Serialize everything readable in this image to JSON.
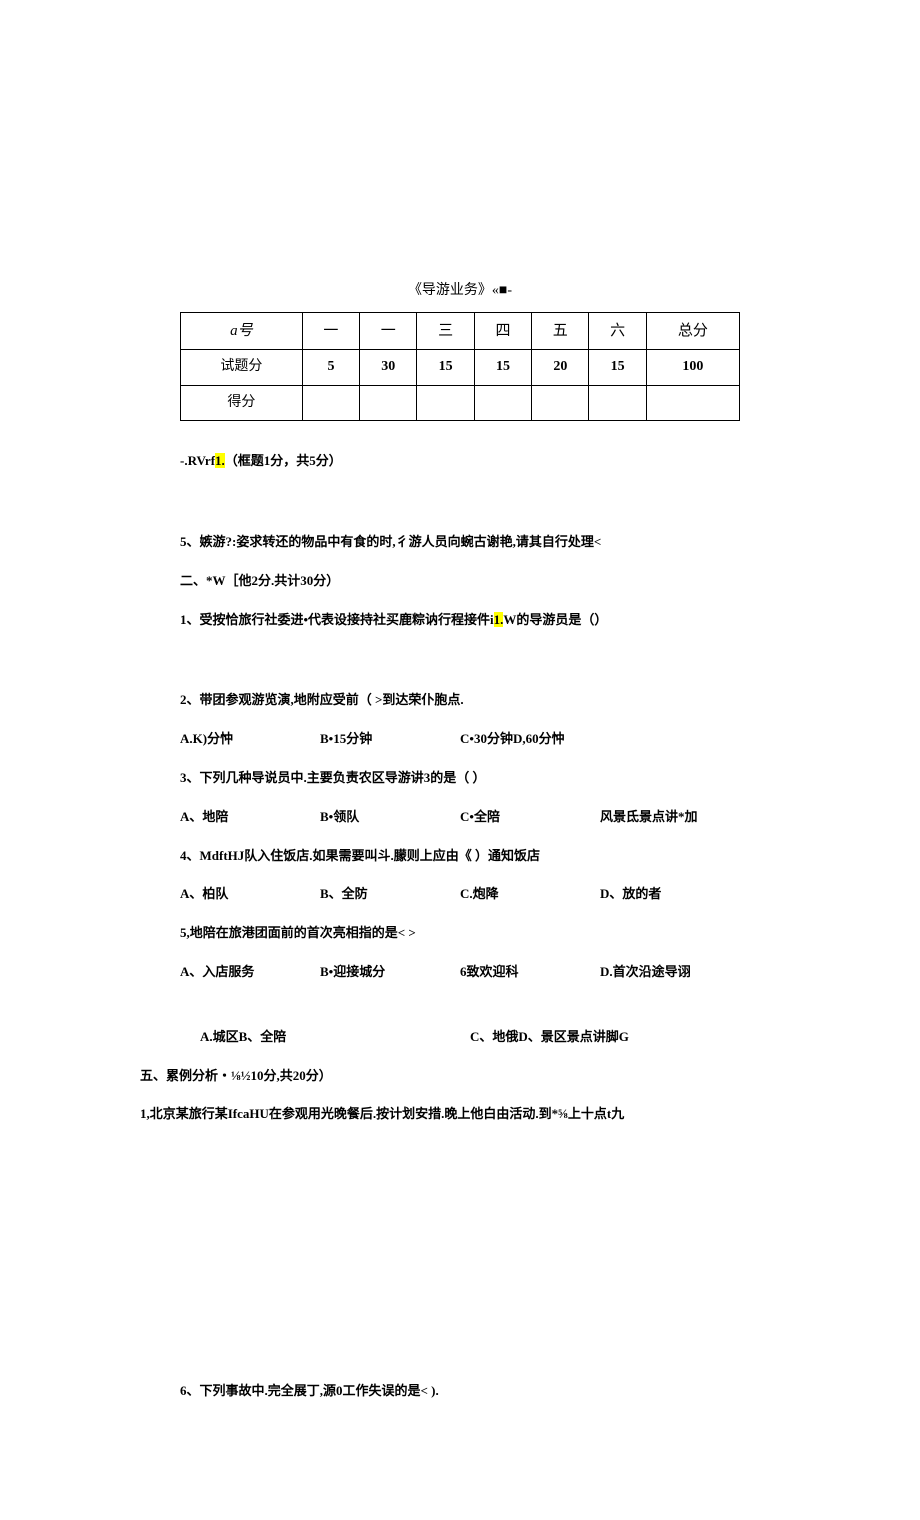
{
  "title": "《导游业务》«■-",
  "table": {
    "headers": [
      "a号",
      "一",
      "一",
      "三",
      "四",
      "五",
      "六",
      "总分"
    ],
    "r1_label": "试题分",
    "r1": [
      "5",
      "30",
      "15",
      "15",
      "20",
      "15",
      "100"
    ],
    "r2_label": "得分"
  },
  "sec1": {
    "head_pre": "-.RVrf",
    "head_hl": "1.",
    "head_post": "（框题1分，共5分）",
    "q5": "5、嫉游?:姿求转还的物品中有食的时,彳游人员向蜿古谢艳,请其自行处理<"
  },
  "sec2": {
    "head": "二、*W［他2分.共计30分）",
    "q1_pre": "1、受按恰旅行社委进•代表设接持社买鹿粽讷行程接件i",
    "q1_hl": "1.",
    "q1_post": "W的导游员是（）",
    "q2": "2、带团参观游览演,地附应受前（            >到达荣仆胞点.",
    "q2_opts": {
      "a": "A.K)分忡",
      "b": "B•15分钟",
      "c": "C•30分钟D,60分忡"
    },
    "q3": "3、下列几种导说员中.主要负责农区导游讲3的是（            ）",
    "q3_opts": {
      "a": "A、地陪",
      "b": "B•领队",
      "c": "C•全陪",
      "d": "风景氐景点讲*加"
    },
    "q4": "4、MdftHJ队入住饭店.如果需要叫斗.朦则上应由《          ）通知饭店",
    "q4_opts": {
      "a": "A、柏队",
      "b": "B、全防",
      "c": "C.炮降",
      "d": "D、放的者"
    },
    "q5": "5,地陪在旅港团面前的首次亮相指的是<             >",
    "q5_opts": {
      "a": "A、入店服务",
      "b": "B•迎接城分",
      "c": "6致欢迎科",
      "d": "D.首次沿途导诩"
    },
    "extra_opts": {
      "a": "A.城区B、全陪",
      "c": "C、地俄D、景区景点讲脚G"
    }
  },
  "sec5": {
    "head": "五、累例分析・⅛½10分,共20分）",
    "q1": "1,北京某旅行某IfcaHU在参观用光晚餐后.按计划安措.晚上他白由活动.到*⅝上十点t九"
  },
  "q6": "6、下列事故中.完全展丁,源0工作失误的是<               ).",
  "chart_data": {
    "type": "table",
    "title": "score table",
    "categories": [
      "一",
      "一",
      "三",
      "四",
      "五",
      "六",
      "总分"
    ],
    "values": [
      5,
      30,
      15,
      15,
      20,
      15,
      100
    ]
  }
}
